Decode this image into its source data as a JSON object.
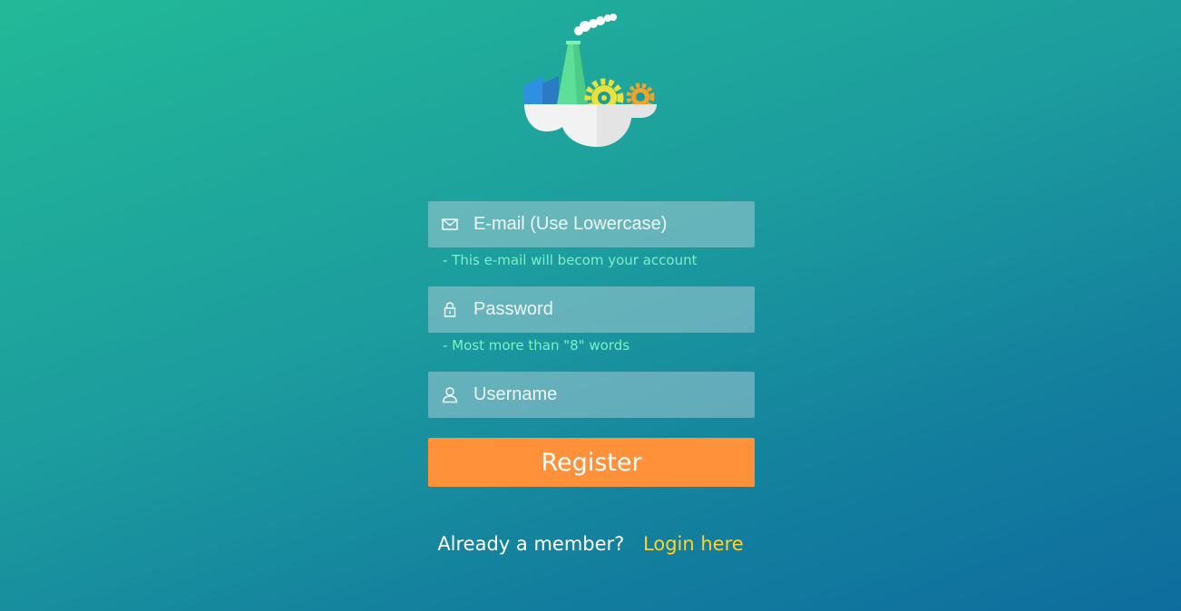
{
  "logo": {
    "icon": "factory-cloud-gears-logo",
    "colors": {
      "chimney": "#5ddf9a",
      "building_blue": "#2f8fe0",
      "gear_yellow": "#e8e23a",
      "gear_orange": "#f0a52a",
      "cloud": "#ffffff"
    }
  },
  "form": {
    "email": {
      "placeholder": "E-mail (Use Lowercase)",
      "value": "",
      "icon": "envelope-icon",
      "hint": "- This e-mail will becom your account"
    },
    "password": {
      "placeholder": "Password",
      "value": "",
      "icon": "lock-icon",
      "hint": "- Most more than \"8\" words"
    },
    "username": {
      "placeholder": "Username",
      "value": "",
      "icon": "user-icon"
    },
    "register_label": "Register"
  },
  "footer": {
    "prompt": "Already a member?",
    "login_link": "Login here"
  },
  "colors": {
    "accent_button": "#ff913a",
    "hint_text": "#7ff0c8",
    "link": "#ffd230"
  }
}
